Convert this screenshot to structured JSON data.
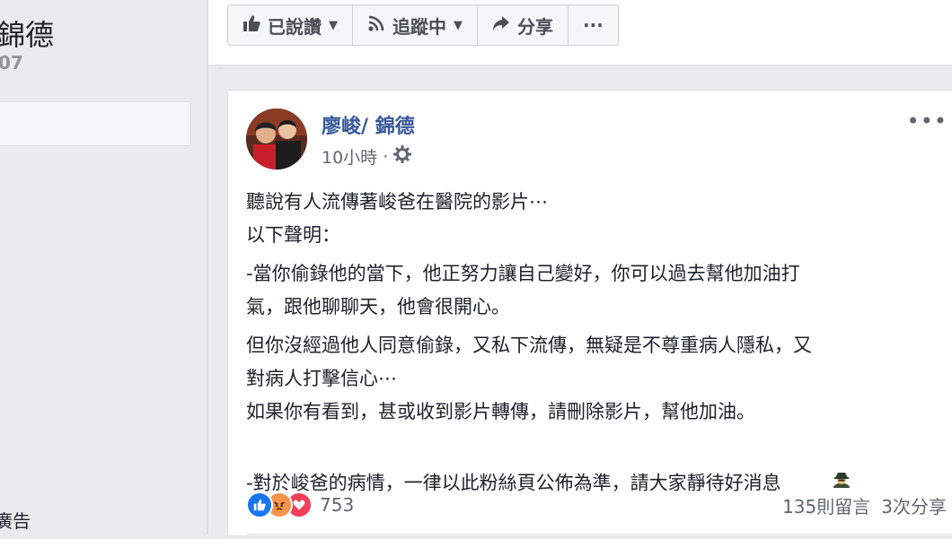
{
  "sidebar": {
    "title": "錦德",
    "handle": "07",
    "ad_label": "廣告"
  },
  "actions": {
    "liked": "已說讚",
    "following": "追蹤中",
    "share": "分享",
    "more": "···"
  },
  "post": {
    "author": "廖峻/ 錦德",
    "time": "10小時",
    "dot": "·",
    "more": "•••",
    "paragraphs": [
      "聽說有人流傳著峻爸在醫院的影片⋯\n以下聲明：",
      "-當你偷錄他的當下，他正努力讓自己變好，你可以過去幫他加油打\n氣，跟他聊聊天，他會很開心。",
      "但你沒經過他人同意偷錄，又私下流傳，無疑是不尊重病人隱私，又\n對病人打擊信心⋯\n如果你有看到，甚或收到影片轉傳，請刪除影片，幫他加油。",
      "-對於峻爸的病情，一律以此粉絲頁公佈為準，請大家靜待好消息"
    ],
    "reaction_count": "753",
    "comments": "135則留言",
    "shares": "3次分享"
  },
  "colors": {
    "link": "#365899",
    "like": "#1877f2",
    "angry": "#f5944a",
    "love": "#f33e58"
  },
  "icons": [
    "thumbs-up-icon",
    "rss-icon",
    "share-arrow-icon",
    "gear-icon",
    "like-reaction-icon",
    "angry-reaction-icon",
    "love-reaction-icon",
    "spy-emoji-icon"
  ]
}
